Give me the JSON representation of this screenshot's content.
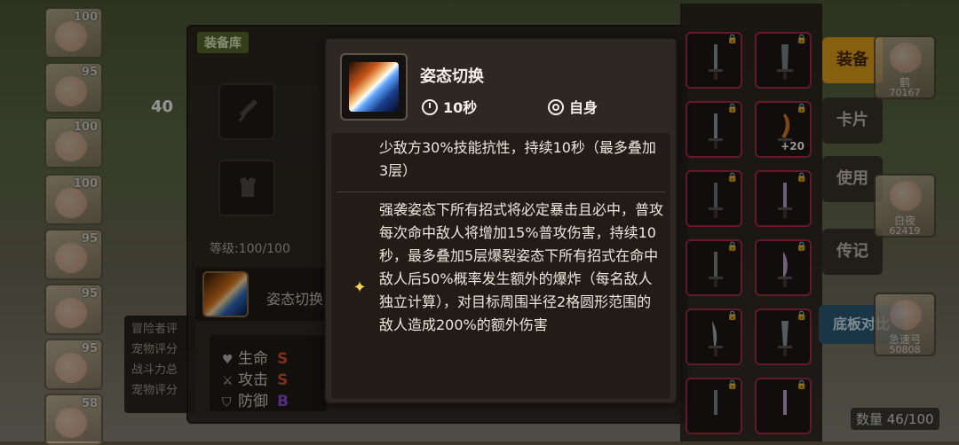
{
  "equipment_panel": {
    "tag": "装备库",
    "level_text": "等级:100/100",
    "power_prefix": "40",
    "skill_name": "姿态切换",
    "stats": [
      {
        "label": "生命",
        "grade": "S",
        "grade_color": "#d6532f"
      },
      {
        "label": "攻击",
        "grade": "S",
        "grade_color": "#d6532f"
      },
      {
        "label": "防御",
        "grade": "B",
        "grade_color": "#8f4fd8"
      }
    ],
    "adventurer_lines": [
      "冒险者评",
      "宠物评分",
      "战斗力总",
      "宠物评分"
    ]
  },
  "left_heroes": [
    {
      "level": "100"
    },
    {
      "level": "95"
    },
    {
      "level": "100"
    },
    {
      "level": "100"
    },
    {
      "level": "95"
    },
    {
      "level": "95"
    },
    {
      "level": "95"
    },
    {
      "level": "58"
    }
  ],
  "right_menu": {
    "equip": "装备",
    "card": "卡片",
    "use": "使用",
    "legend": "传记",
    "compare": "底板对比"
  },
  "right_heroes": [
    {
      "name": "鹤",
      "power": "70167"
    },
    {
      "name": "白夜",
      "power": "62419"
    },
    {
      "name": "急速弓",
      "power": "50808"
    }
  ],
  "item_plus": "+20",
  "inventory_count": "数量 46/100",
  "tooltip": {
    "title": "姿态切换",
    "cooldown": "10秒",
    "target": "自身",
    "desc_part1": "少敌方30%技能抗性，持续10秒（最多叠加3层）",
    "desc_part2": "强袭姿态下所有招式将必定暴击且必中，普攻每次命中敌人将增加15%普攻伤害，持续10秒，最多叠加5层爆裂姿态下所有招式在命中敌人后50%概率发生额外的爆炸（每名敌人独立计算），对目标周围半径2格圆形范围的敌人造成200%的额外伤害",
    "accent_color": "#ffd34d"
  }
}
